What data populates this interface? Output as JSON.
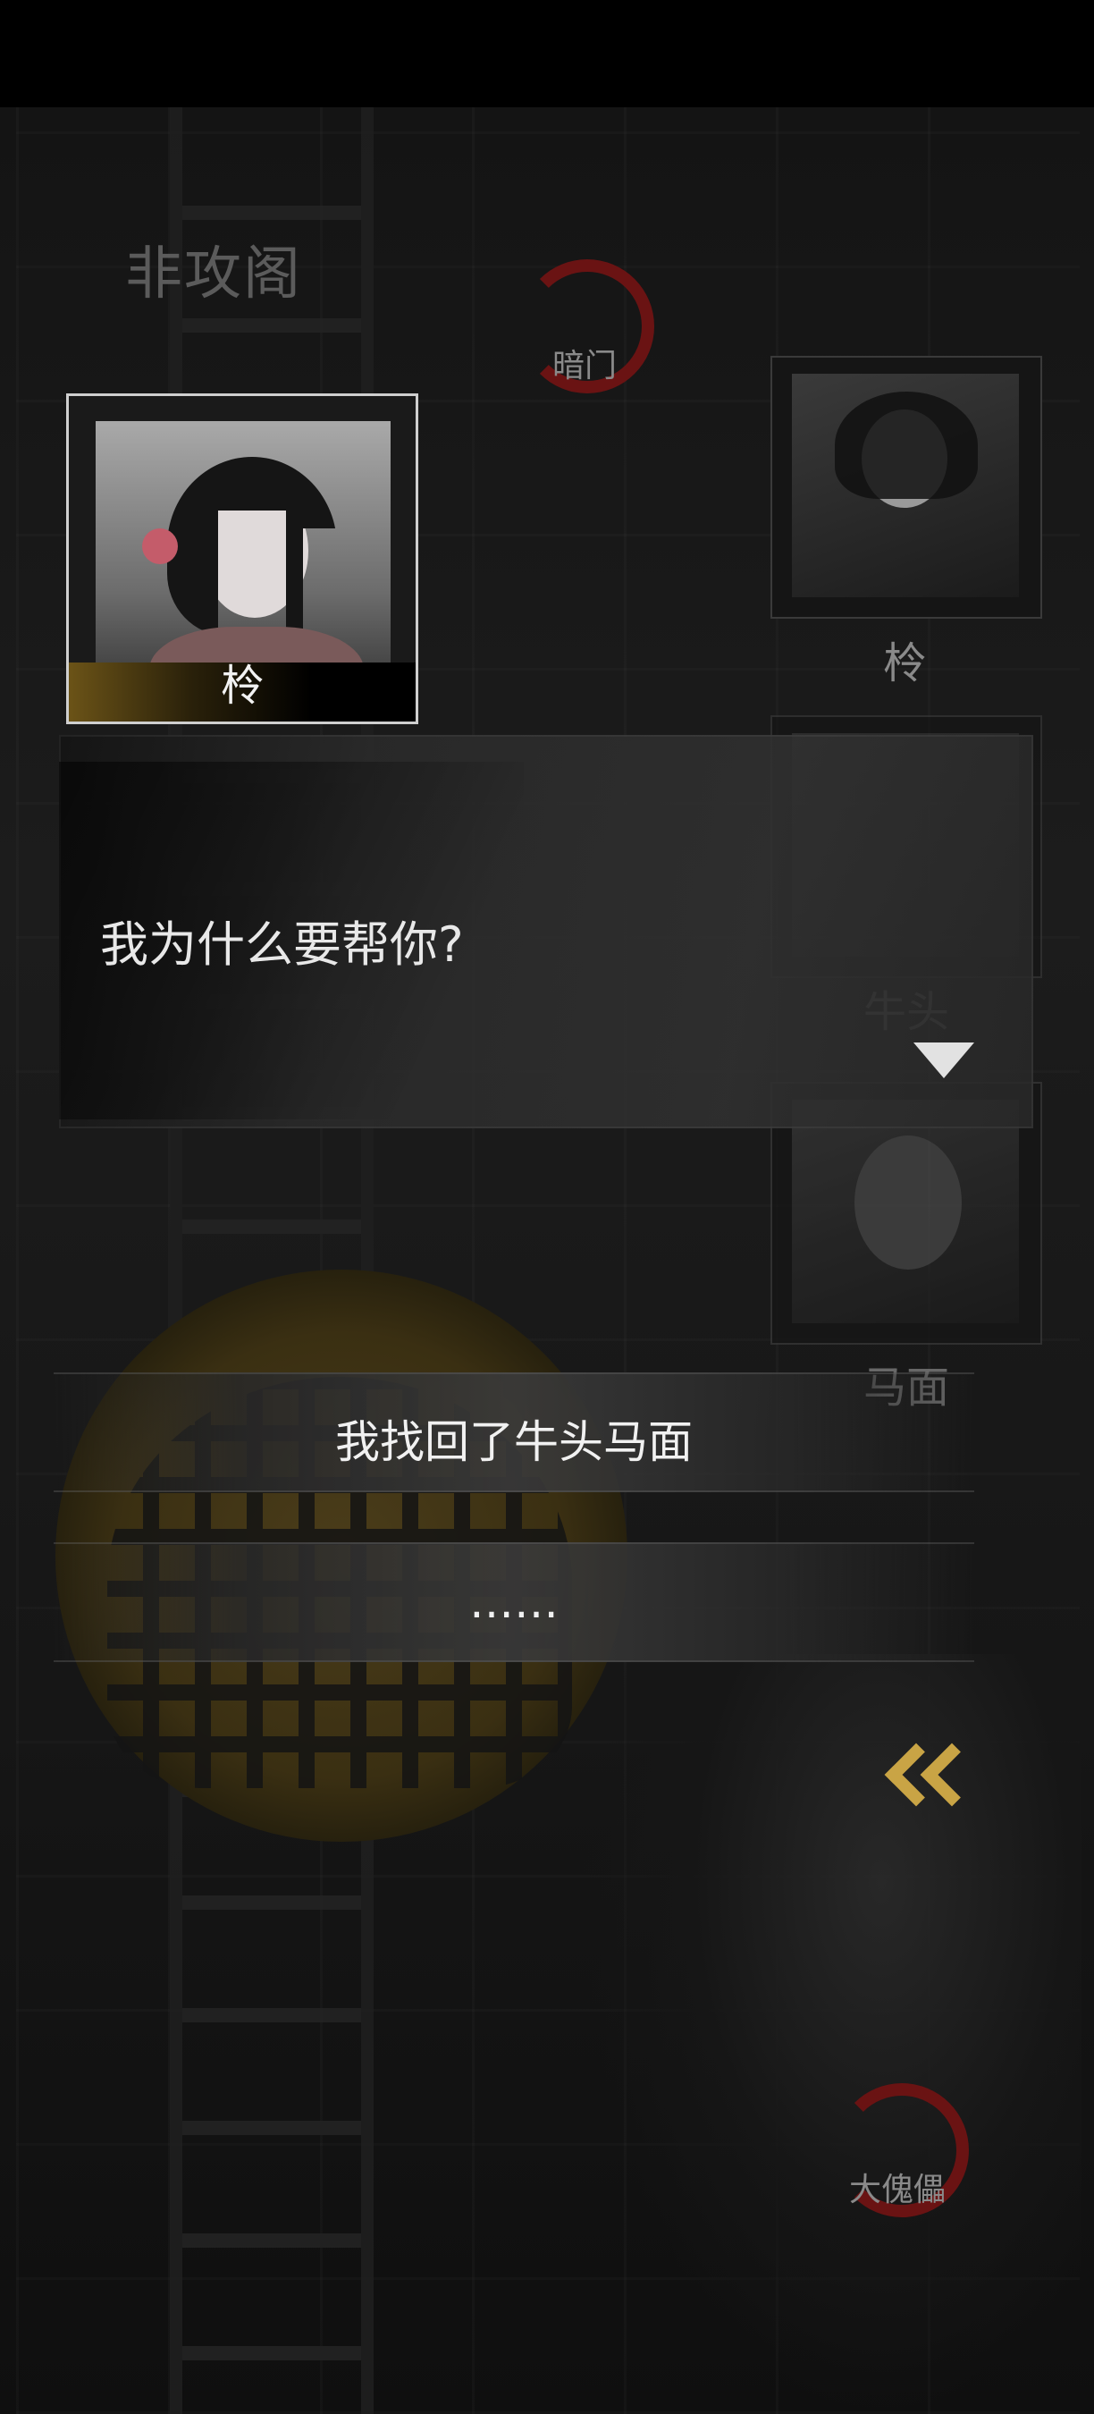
{
  "location": {
    "title": "非攻阁"
  },
  "markers": {
    "dark_gate": "暗门",
    "puppet": "大傀儡"
  },
  "speaker": {
    "name": "柃"
  },
  "dialog": {
    "text": "我为什么要帮你?"
  },
  "side_characters": [
    {
      "name": "柃"
    },
    {
      "name": "牛头"
    },
    {
      "name": "马面"
    }
  ],
  "choices": [
    {
      "text": "我找回了牛头马面"
    },
    {
      "text": "……"
    }
  ],
  "colors": {
    "accent_red": "#6a1313",
    "gold": "#c9a445"
  }
}
